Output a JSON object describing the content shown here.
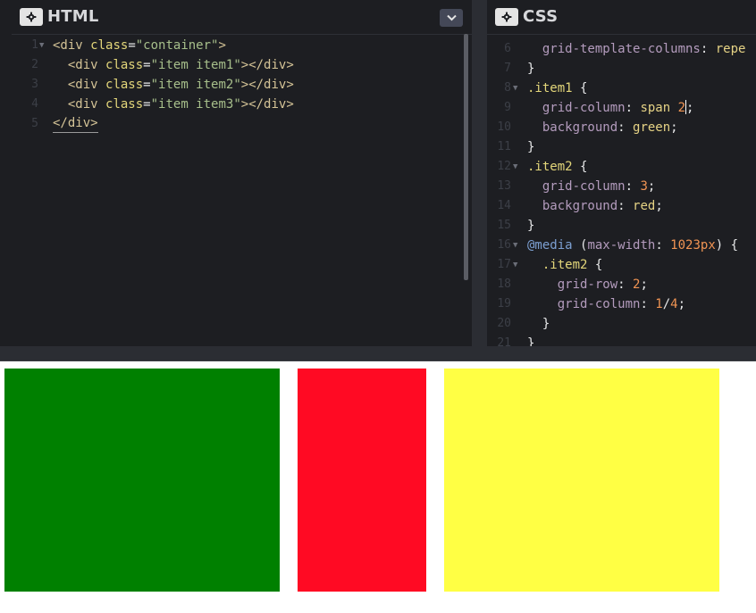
{
  "html_panel": {
    "title": "HTML",
    "lines": [
      {
        "num": "1",
        "fold": "▼",
        "tokens": [
          [
            "t-tag",
            "<div "
          ],
          [
            "t-attr",
            "class"
          ],
          [
            "t-punc",
            "="
          ],
          [
            "t-str",
            "\"container\""
          ],
          [
            "t-tag",
            ">"
          ]
        ]
      },
      {
        "num": "2",
        "fold": "",
        "tokens": [
          [
            "t-tag",
            "  <div "
          ],
          [
            "t-attr",
            "class"
          ],
          [
            "t-punc",
            "="
          ],
          [
            "t-str",
            "\"item item1\""
          ],
          [
            "t-tag",
            "></div>"
          ]
        ]
      },
      {
        "num": "3",
        "fold": "",
        "tokens": [
          [
            "t-tag",
            "  <div "
          ],
          [
            "t-attr",
            "class"
          ],
          [
            "t-punc",
            "="
          ],
          [
            "t-str",
            "\"item item2\""
          ],
          [
            "t-tag",
            "></div>"
          ]
        ]
      },
      {
        "num": "4",
        "fold": "",
        "tokens": [
          [
            "t-tag",
            "  <div "
          ],
          [
            "t-attr",
            "class"
          ],
          [
            "t-punc",
            "="
          ],
          [
            "t-str",
            "\"item item3\""
          ],
          [
            "t-tag",
            "></div>"
          ]
        ]
      },
      {
        "num": "5",
        "fold": "",
        "tokens": [
          [
            "t-tag",
            "</div>"
          ]
        ]
      }
    ]
  },
  "css_panel": {
    "title": "CSS",
    "lines": [
      {
        "num": "6",
        "fold": "",
        "tokens": [
          [
            "t-prop",
            "  grid-template-columns"
          ],
          [
            "t-punc",
            ": "
          ],
          [
            "t-kw",
            "repe"
          ]
        ]
      },
      {
        "num": "7",
        "fold": "",
        "tokens": [
          [
            "t-punc",
            "}"
          ]
        ]
      },
      {
        "num": "8",
        "fold": "▼",
        "tokens": [
          [
            "t-sel",
            ".item1 "
          ],
          [
            "t-punc",
            "{"
          ]
        ]
      },
      {
        "num": "9",
        "fold": "",
        "tokens": [
          [
            "t-prop",
            "  grid-column"
          ],
          [
            "t-punc",
            ": "
          ],
          [
            "t-kw",
            "span "
          ],
          [
            "t-num",
            "2"
          ],
          [
            "cursor",
            ""
          ],
          [
            "t-punc",
            ";"
          ]
        ]
      },
      {
        "num": "10",
        "fold": "",
        "tokens": [
          [
            "t-prop",
            "  background"
          ],
          [
            "t-punc",
            ": "
          ],
          [
            "t-kw",
            "green"
          ],
          [
            "t-punc",
            ";"
          ]
        ]
      },
      {
        "num": "11",
        "fold": "",
        "tokens": [
          [
            "t-punc",
            "}"
          ]
        ]
      },
      {
        "num": "12",
        "fold": "▼",
        "tokens": [
          [
            "t-sel",
            ".item2 "
          ],
          [
            "t-punc",
            "{"
          ]
        ]
      },
      {
        "num": "13",
        "fold": "",
        "tokens": [
          [
            "t-prop",
            "  grid-column"
          ],
          [
            "t-punc",
            ": "
          ],
          [
            "t-num",
            "3"
          ],
          [
            "t-punc",
            ";"
          ]
        ]
      },
      {
        "num": "14",
        "fold": "",
        "tokens": [
          [
            "t-prop",
            "  background"
          ],
          [
            "t-punc",
            ": "
          ],
          [
            "t-kw",
            "red"
          ],
          [
            "t-punc",
            ";"
          ]
        ]
      },
      {
        "num": "15",
        "fold": "",
        "tokens": [
          [
            "t-punc",
            "}"
          ]
        ]
      },
      {
        "num": "16",
        "fold": "▼",
        "tokens": [
          [
            "t-at",
            "@media "
          ],
          [
            "t-punc",
            "("
          ],
          [
            "t-prop",
            "max-width"
          ],
          [
            "t-punc",
            ": "
          ],
          [
            "t-num",
            "1023px"
          ],
          [
            "t-punc",
            ") {"
          ]
        ]
      },
      {
        "num": "17",
        "fold": "▼",
        "tokens": [
          [
            "t-sel",
            "  .item2 "
          ],
          [
            "t-punc",
            "{"
          ]
        ]
      },
      {
        "num": "18",
        "fold": "",
        "tokens": [
          [
            "t-prop",
            "    grid-row"
          ],
          [
            "t-punc",
            ": "
          ],
          [
            "t-num",
            "2"
          ],
          [
            "t-punc",
            ";"
          ]
        ]
      },
      {
        "num": "19",
        "fold": "",
        "tokens": [
          [
            "t-prop",
            "    grid-column"
          ],
          [
            "t-punc",
            ": "
          ],
          [
            "t-num",
            "1"
          ],
          [
            "t-punc",
            "/"
          ],
          [
            "t-num",
            "4"
          ],
          [
            "t-punc",
            ";"
          ]
        ]
      },
      {
        "num": "20",
        "fold": "",
        "tokens": [
          [
            "t-punc",
            "  }"
          ]
        ]
      },
      {
        "num": "21",
        "fold": "",
        "tokens": [
          [
            "t-punc",
            "}"
          ]
        ]
      }
    ]
  },
  "preview": {
    "boxes": [
      {
        "name": "item1-box",
        "color": "#008000"
      },
      {
        "name": "item2-box",
        "color": "#ff0a23"
      },
      {
        "name": "item3-box",
        "color": "#ffff44"
      }
    ]
  },
  "colors": {
    "editor_bg": "#1d1e22",
    "button_light": "#e4e4e4",
    "button_dark": "#444857"
  }
}
